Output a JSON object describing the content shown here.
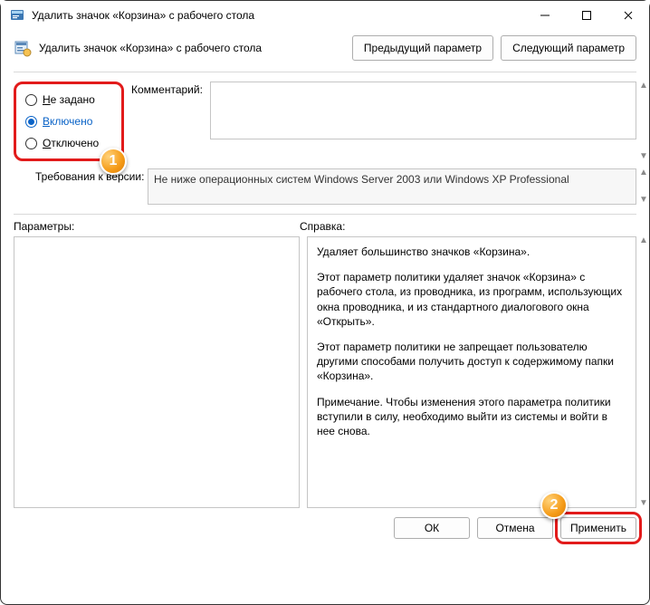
{
  "window": {
    "title": "Удалить значок «Корзина» с рабочего стола"
  },
  "header": {
    "title": "Удалить значок «Корзина» с рабочего стола",
    "prev": "Предыдущий параметр",
    "next": "Следующий параметр"
  },
  "states": {
    "not_configured": "Не задано",
    "enabled": "Включено",
    "disabled": "Отключено",
    "selected": "enabled"
  },
  "labels": {
    "comment": "Комментарий:",
    "supported_on": "Требования к версии:",
    "options": "Параметры:",
    "help": "Справка:"
  },
  "comment": "",
  "supported_on": "Не ниже операционных систем Windows Server 2003 или Windows XP Professional",
  "help": {
    "p1": "Удаляет большинство значков «Корзина».",
    "p2": "Этот параметр политики удаляет значок «Корзина» с рабочего стола, из проводника, из программ, использующих окна проводника, и из стандартного диалогового окна «Открыть».",
    "p3": "Этот параметр политики не запрещает пользователю другими способами получить доступ к содержимому папки «Корзина».",
    "p4": "Примечание. Чтобы изменения этого параметра политики вступили в силу, необходимо выйти из системы и войти в нее снова."
  },
  "buttons": {
    "ok": "ОК",
    "cancel": "Отмена",
    "apply": "Применить"
  },
  "annotations": {
    "badge1": "1",
    "badge2": "2"
  }
}
